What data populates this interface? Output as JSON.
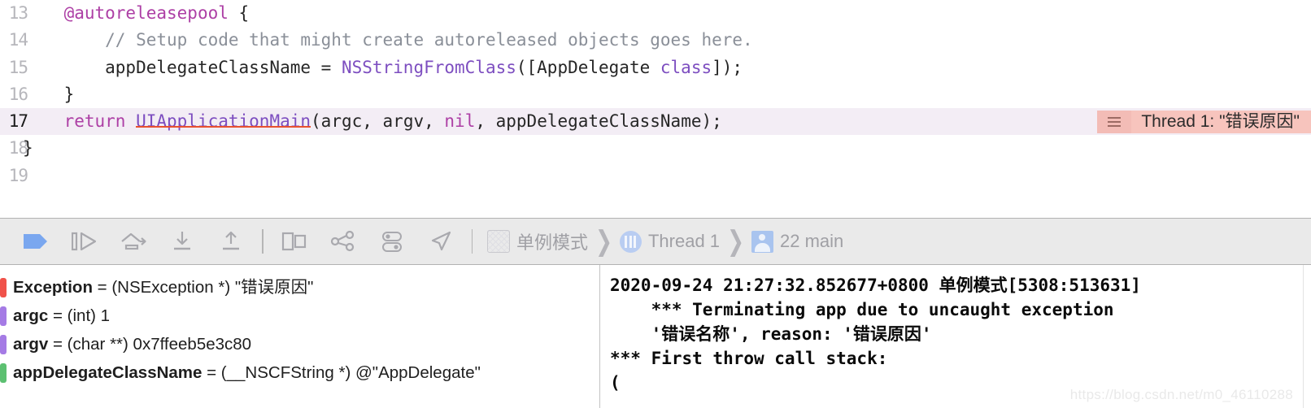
{
  "editor": {
    "lines": [
      {
        "number": "13",
        "indent": 0,
        "highlight": false,
        "tokens": [
          {
            "t": "    ",
            "c": "plain"
          },
          {
            "t": "@autoreleasepool",
            "c": "kw"
          },
          {
            "t": " {",
            "c": "plain"
          }
        ]
      },
      {
        "number": "14",
        "indent": 0,
        "highlight": false,
        "tokens": [
          {
            "t": "        ",
            "c": "plain"
          },
          {
            "t": "// Setup code that might create autoreleased objects goes here.",
            "c": "comment"
          }
        ]
      },
      {
        "number": "15",
        "indent": 0,
        "highlight": false,
        "tokens": [
          {
            "t": "        appDelegateClassName = ",
            "c": "plain"
          },
          {
            "t": "NSStringFromClass",
            "c": "type"
          },
          {
            "t": "([AppDelegate ",
            "c": "plain"
          },
          {
            "t": "class",
            "c": "type"
          },
          {
            "t": "]);",
            "c": "plain"
          }
        ]
      },
      {
        "number": "16",
        "indent": 0,
        "highlight": false,
        "tokens": [
          {
            "t": "    }",
            "c": "plain"
          }
        ]
      },
      {
        "number": "17",
        "indent": 0,
        "highlight": true,
        "tokens": [
          {
            "t": "    ",
            "c": "plain"
          },
          {
            "t": "return",
            "c": "kw"
          },
          {
            "t": " ",
            "c": "plain"
          },
          {
            "t": "UIApplicationMain",
            "c": "fn"
          },
          {
            "t": "(argc, argv, ",
            "c": "plain"
          },
          {
            "t": "nil",
            "c": "kw"
          },
          {
            "t": ", appDelegateClassName);",
            "c": "plain"
          }
        ]
      },
      {
        "number": "18",
        "indent": 0,
        "highlight": false,
        "tokens": [
          {
            "t": "}",
            "c": "plain"
          }
        ]
      },
      {
        "number": "19",
        "indent": 0,
        "highlight": false,
        "tokens": []
      }
    ],
    "error_badge": {
      "text": "Thread 1: \"错误原因\"",
      "handle_icon": "list-lines-icon",
      "bg_color": "#f7c4bd",
      "handle_color": "#f3bcb6"
    },
    "highlight_color": "#f3edf5"
  },
  "debug_bar": {
    "buttons": [
      {
        "name": "breakpoint-toggle-button",
        "icon": "breakpoint-arrow-icon"
      },
      {
        "name": "continue-button",
        "icon": "continue-execution-icon"
      },
      {
        "name": "step-over-button",
        "icon": "step-over-icon"
      },
      {
        "name": "step-into-button",
        "icon": "step-into-icon"
      },
      {
        "name": "step-out-button",
        "icon": "step-out-icon"
      },
      {
        "name": "debug-view-hierarchy-button",
        "icon": "view-hierarchy-icon"
      },
      {
        "name": "memory-graph-button",
        "icon": "memory-graph-icon"
      },
      {
        "name": "environment-overrides-button",
        "icon": "toggles-icon"
      },
      {
        "name": "simulate-location-button",
        "icon": "location-arrow-icon"
      }
    ],
    "breadcrumb": [
      {
        "name": "process-crumb",
        "label": "单例模式",
        "icon": "scheme-icon"
      },
      {
        "name": "thread-crumb",
        "label": "Thread 1",
        "icon": "thread-icon"
      },
      {
        "name": "frame-crumb",
        "label": "22 main",
        "icon": "stack-frame-icon"
      }
    ],
    "separator_char": "❯"
  },
  "variables": {
    "rows": [
      {
        "chip_color": "#f0524a",
        "name": "Exception",
        "rest": " = (NSException *) \"错误原因\""
      },
      {
        "chip_color": "#a57be5",
        "name": "argc",
        "rest": " = (int) 1"
      },
      {
        "chip_color": "#a57be5",
        "name": "argv",
        "rest": " = (char **) 0x7ffeeb5e3c80"
      },
      {
        "chip_color": "#5cc071",
        "name": "appDelegateClassName",
        "rest": " = (__NSCFString *) @\"AppDelegate\""
      }
    ]
  },
  "console": {
    "lines": [
      "2020-09-24 21:27:32.852677+0800 单例模式[5308:513631]",
      "    *** Terminating app due to uncaught exception",
      "    '错误名称', reason: '错误原因'",
      "*** First throw call stack:",
      "("
    ],
    "watermark": "https://blog.csdn.net/m0_46110288"
  }
}
